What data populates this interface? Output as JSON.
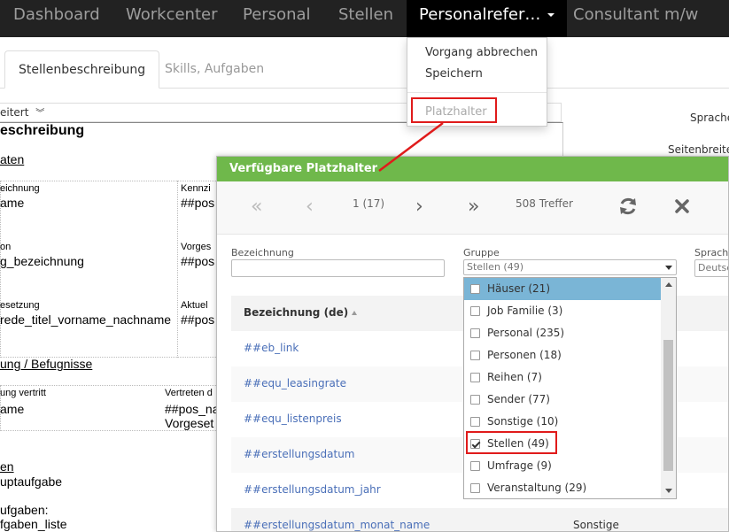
{
  "nav": {
    "items": [
      "Dashboard",
      "Workcenter",
      "Personal",
      "Stellen",
      "Personalrefer…",
      "Consultant m/w"
    ]
  },
  "menu": {
    "items": [
      "Vorgang abbrechen",
      "Speichern"
    ],
    "disabled_item": "Platzhalter"
  },
  "tabs": [
    "Stellenbeschreibung",
    "Skills, Aufgaben"
  ],
  "doc": {
    "toolbar_text": "eitert",
    "heading": "eschreibung",
    "section1": "aten",
    "cells": [
      {
        "label": "eichnung",
        "value": "ame"
      },
      {
        "label": "Kennzi",
        "value": "##pos"
      },
      {
        "label": "on",
        "value": "g_bezeichnung"
      },
      {
        "label": "Vorges",
        "value": "##pos"
      },
      {
        "label": "esetzung",
        "value": "rede_titel_vorname_nachname"
      },
      {
        "label": "Aktuel",
        "value": "##pos"
      }
    ],
    "section2": "ung / Befugnisse",
    "cells2": [
      {
        "label": "ung vertritt",
        "value": "ame"
      },
      {
        "label": "Vertreten d",
        "value": "##pos_na"
      }
    ],
    "extra_value": "Vorgeset",
    "section3": "en",
    "line3": "uptaufgabe",
    "line4": "ufgaben:",
    "line5": "fgaben_liste"
  },
  "right_labels": [
    "Sprache",
    "Seitenbreite"
  ],
  "modal": {
    "title": "Verfügbare Platzhalter",
    "page_info": "1 (17)",
    "hits": "508 Treffer",
    "filters": {
      "bezeichnung_label": "Bezeichnung",
      "gruppe_label": "Gruppe",
      "gruppe_value": "Stellen (49)",
      "sprache_label": "Sprache",
      "sprache_value": "Deutsc"
    },
    "column_header": "Bezeichnung (de)",
    "rows": [
      {
        "label": "##eb_link",
        "group": ""
      },
      {
        "label": "##equ_leasingrate",
        "group": ""
      },
      {
        "label": "##equ_listenpreis",
        "group": ""
      },
      {
        "label": "##erstellungsdatum",
        "group": ""
      },
      {
        "label": "##erstellungsdatum_jahr",
        "group": ""
      },
      {
        "label": "##erstellungsdatum_monat_name",
        "group": "Sonstige"
      }
    ]
  },
  "group_options": [
    {
      "label": "Häuser (21)",
      "checked": false,
      "highlight": true
    },
    {
      "label": "Job Familie (3)",
      "checked": false,
      "highlight": false
    },
    {
      "label": "Personal (235)",
      "checked": false,
      "highlight": false
    },
    {
      "label": "Personen (18)",
      "checked": false,
      "highlight": false
    },
    {
      "label": "Reihen (7)",
      "checked": false,
      "highlight": false
    },
    {
      "label": "Sender (77)",
      "checked": false,
      "highlight": false
    },
    {
      "label": "Sonstige (10)",
      "checked": false,
      "highlight": false
    },
    {
      "label": "Stellen (49)",
      "checked": true,
      "highlight": false
    },
    {
      "label": "Umfrage (9)",
      "checked": false,
      "highlight": false
    },
    {
      "label": "Veranstaltung (29)",
      "checked": false,
      "highlight": false
    }
  ],
  "colors": {
    "modal_header": "#6fb84b",
    "annotation": "#e01b1b",
    "link": "#4a6fb8",
    "highlight": "#7ab5d6"
  }
}
